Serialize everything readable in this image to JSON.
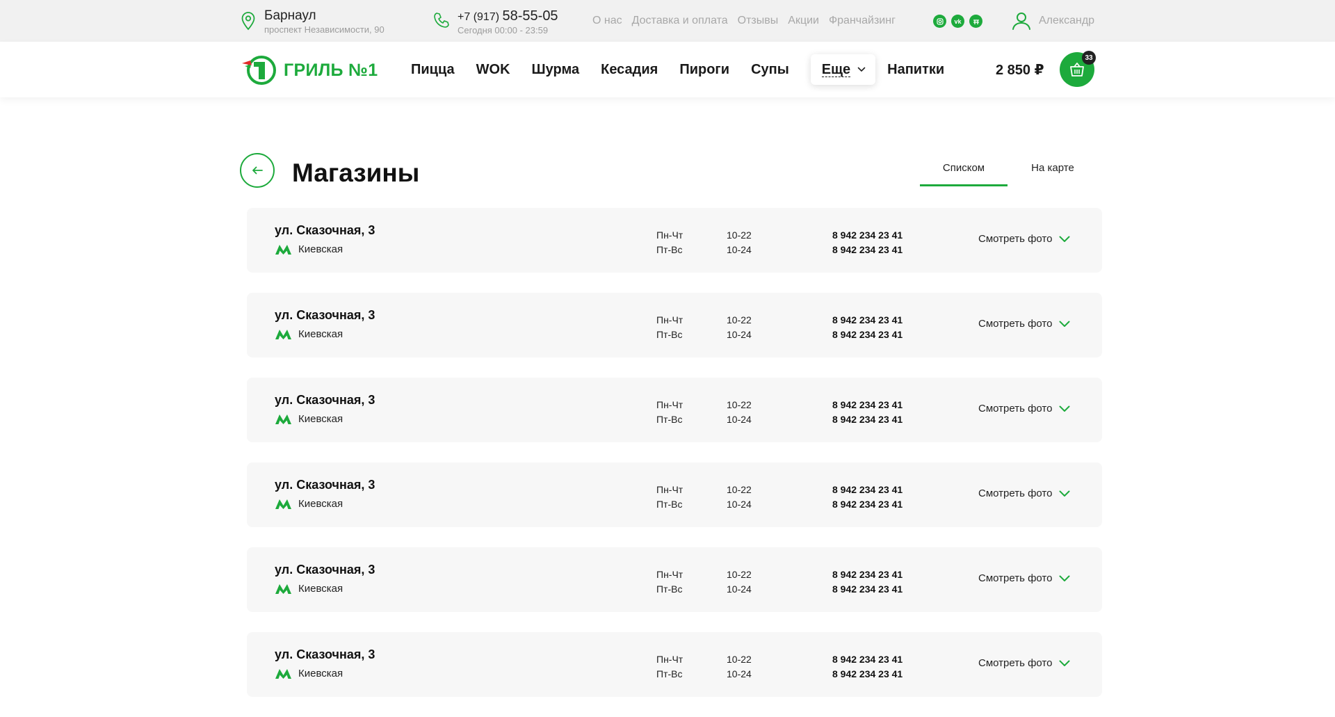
{
  "topbar": {
    "city": "Барнаул",
    "address": "проспект Независимости, 90",
    "phone_prefix": "+7 (917)",
    "phone_number": "58-55-05",
    "hours": "Сегодня 00:00 - 23:59",
    "links": [
      "О нас",
      "Доставка и оплата",
      "Отзывы",
      "Акции",
      "Франчайзинг"
    ],
    "social": [
      "instagram-icon",
      "vk-icon",
      "telegram-icon"
    ],
    "user_name": "Александр"
  },
  "header": {
    "logo_text": "ГРИЛЬ №1",
    "nav": [
      "Пицца",
      "WOK",
      "Шурма",
      "Кесадия",
      "Пироги",
      "Супы"
    ],
    "more_label": "Еще",
    "nav_after": "Напитки",
    "price": "2 850 ₽",
    "cart_count": "33"
  },
  "page": {
    "title": "Магазины",
    "tabs": [
      "Списком",
      "На карте"
    ],
    "active_tab": "Списком"
  },
  "stores": [
    {
      "address": "ул. Сказочная, 3",
      "metro": "Киевская",
      "days1": "Пн-Чт",
      "days2": "Пт-Вс",
      "hours1": "10-22",
      "hours2": "10-24",
      "phone1": "8 942 234 23 41",
      "phone2": "8 942 234 23 41",
      "photo_label": "Смотреть фото"
    },
    {
      "address": "ул. Сказочная, 3",
      "metro": "Киевская",
      "days1": "Пн-Чт",
      "days2": "Пт-Вс",
      "hours1": "10-22",
      "hours2": "10-24",
      "phone1": "8 942 234 23 41",
      "phone2": "8 942 234 23 41",
      "photo_label": "Смотреть фото"
    },
    {
      "address": "ул. Сказочная, 3",
      "metro": "Киевская",
      "days1": "Пн-Чт",
      "days2": "Пт-Вс",
      "hours1": "10-22",
      "hours2": "10-24",
      "phone1": "8 942 234 23 41",
      "phone2": "8 942 234 23 41",
      "photo_label": "Смотреть фото"
    },
    {
      "address": "ул. Сказочная, 3",
      "metro": "Киевская",
      "days1": "Пн-Чт",
      "days2": "Пт-Вс",
      "hours1": "10-22",
      "hours2": "10-24",
      "phone1": "8 942 234 23 41",
      "phone2": "8 942 234 23 41",
      "photo_label": "Смотреть фото"
    },
    {
      "address": "ул. Сказочная, 3",
      "metro": "Киевская",
      "days1": "Пн-Чт",
      "days2": "Пт-Вс",
      "hours1": "10-22",
      "hours2": "10-24",
      "phone1": "8 942 234 23 41",
      "phone2": "8 942 234 23 41",
      "photo_label": "Смотреть фото"
    },
    {
      "address": "ул. Сказочная, 3",
      "metro": "Киевская",
      "days1": "Пн-Чт",
      "days2": "Пт-Вс",
      "hours1": "10-22",
      "hours2": "10-24",
      "phone1": "8 942 234 23 41",
      "phone2": "8 942 234 23 41",
      "photo_label": "Смотреть фото"
    }
  ],
  "colors": {
    "accent": "#1daa3c",
    "topbar_bg": "#f1f1f1",
    "card_bg": "#f7f7f7"
  }
}
